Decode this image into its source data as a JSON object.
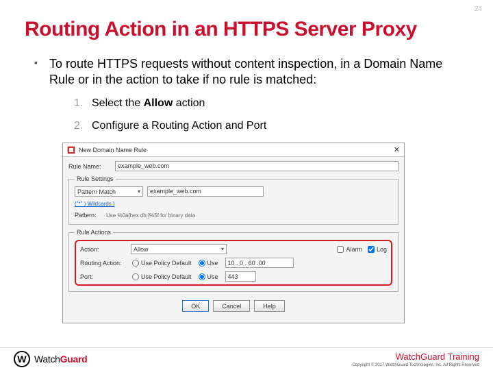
{
  "page_number": "24",
  "title": "Routing Action in an HTTPS Server Proxy",
  "bullet": "To route HTTPS requests without content inspection, in a Domain Name Rule or in the action to take if no rule is matched:",
  "steps": {
    "s1_a": "Select the ",
    "s1_b": "Allow",
    "s1_c": " action",
    "s2": "Configure a Routing Action and Port"
  },
  "dialog": {
    "window_title": "New Domain Name Rule",
    "close": "✕",
    "name_label": "Rule Name:",
    "name_value": "example_web.com",
    "settings_legend": "Rule Settings",
    "match_type": "Pattern Match",
    "match_value": "example_web.com",
    "wildcard_hint": "(\"*\" ) Wildcards )",
    "pattern_label": "Pattern:",
    "pattern_hint": "Use %0a[hex db:]%5f for binary data",
    "actions_legend": "Rule Actions",
    "action_label": "Action:",
    "action_value": "Allow",
    "alarm": "Alarm",
    "log": "Log",
    "routing_label": "Routing Action:",
    "use_default": "Use Policy Default",
    "use": "Use",
    "ip_value": "10 . 0 . 60 .00",
    "port_label": "Port:",
    "port_value": "443",
    "ok": "OK",
    "cancel": "Cancel",
    "help": "Help"
  },
  "footer": {
    "brand_a": "Watch",
    "brand_b": "Guard",
    "training": "WatchGuard Training",
    "copyright": "Copyright © 2017 WatchGuard Technologies, Inc. All Rights Reserved"
  }
}
